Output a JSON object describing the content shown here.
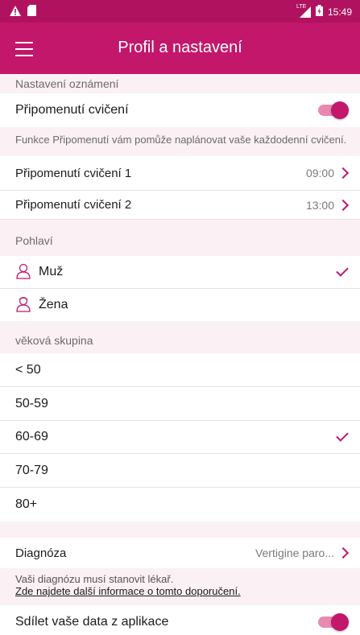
{
  "statusbar": {
    "network": "LTE",
    "time": "15:49"
  },
  "appbar": {
    "title": "Profil a nastavení"
  },
  "notifications": {
    "header": "Nastavení oznámení",
    "reminder_label": "Připomenutí cvičení",
    "reminder_enabled": true,
    "info": "Funkce Připomenutí vám pomůže naplánovat vaše každodenní cvičení.",
    "items": [
      {
        "label": "Připomenutí cvičení 1",
        "time": "09:00"
      },
      {
        "label": "Připomenutí cvičení 2",
        "time": "13:00"
      }
    ]
  },
  "gender": {
    "header": "Pohlaví",
    "options": [
      {
        "label": "Muž",
        "selected": true
      },
      {
        "label": "Žena",
        "selected": false
      }
    ]
  },
  "age": {
    "header": "věková skupina",
    "options": [
      {
        "label": "< 50",
        "selected": false
      },
      {
        "label": "50-59",
        "selected": false
      },
      {
        "label": "60-69",
        "selected": true
      },
      {
        "label": "70-79",
        "selected": false
      },
      {
        "label": "80+",
        "selected": false
      }
    ]
  },
  "diagnosis": {
    "label": "Diagnóza",
    "value": "Vertigine paro...",
    "info": "Vaši diagnózu musí stanovit lékař.",
    "link": "Zde najdete další informace o tomto doporučení."
  },
  "share": {
    "label": "Sdílet vaše data z aplikace",
    "enabled": true
  },
  "colors": {
    "primary": "#c2176b",
    "statusbar": "#b0125f",
    "section_bg": "#fbf0f4"
  }
}
